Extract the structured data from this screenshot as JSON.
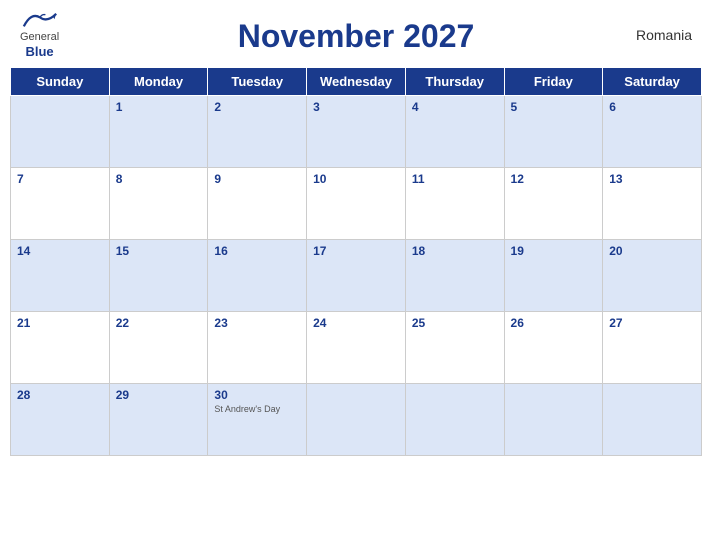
{
  "header": {
    "title": "November 2027",
    "country": "Romania",
    "logo": {
      "general": "General",
      "blue": "Blue"
    }
  },
  "weekdays": [
    "Sunday",
    "Monday",
    "Tuesday",
    "Wednesday",
    "Thursday",
    "Friday",
    "Saturday"
  ],
  "weeks": [
    [
      {
        "day": "",
        "holiday": ""
      },
      {
        "day": "1",
        "holiday": ""
      },
      {
        "day": "2",
        "holiday": ""
      },
      {
        "day": "3",
        "holiday": ""
      },
      {
        "day": "4",
        "holiday": ""
      },
      {
        "day": "5",
        "holiday": ""
      },
      {
        "day": "6",
        "holiday": ""
      }
    ],
    [
      {
        "day": "7",
        "holiday": ""
      },
      {
        "day": "8",
        "holiday": ""
      },
      {
        "day": "9",
        "holiday": ""
      },
      {
        "day": "10",
        "holiday": ""
      },
      {
        "day": "11",
        "holiday": ""
      },
      {
        "day": "12",
        "holiday": ""
      },
      {
        "day": "13",
        "holiday": ""
      }
    ],
    [
      {
        "day": "14",
        "holiday": ""
      },
      {
        "day": "15",
        "holiday": ""
      },
      {
        "day": "16",
        "holiday": ""
      },
      {
        "day": "17",
        "holiday": ""
      },
      {
        "day": "18",
        "holiday": ""
      },
      {
        "day": "19",
        "holiday": ""
      },
      {
        "day": "20",
        "holiday": ""
      }
    ],
    [
      {
        "day": "21",
        "holiday": ""
      },
      {
        "day": "22",
        "holiday": ""
      },
      {
        "day": "23",
        "holiday": ""
      },
      {
        "day": "24",
        "holiday": ""
      },
      {
        "day": "25",
        "holiday": ""
      },
      {
        "day": "26",
        "holiday": ""
      },
      {
        "day": "27",
        "holiday": ""
      }
    ],
    [
      {
        "day": "28",
        "holiday": ""
      },
      {
        "day": "29",
        "holiday": ""
      },
      {
        "day": "30",
        "holiday": "St Andrew's Day"
      },
      {
        "day": "",
        "holiday": ""
      },
      {
        "day": "",
        "holiday": ""
      },
      {
        "day": "",
        "holiday": ""
      },
      {
        "day": "",
        "holiday": ""
      }
    ]
  ],
  "colors": {
    "header_bg": "#1a3a8c",
    "header_text": "#ffffff",
    "row_odd": "#dce6f7",
    "row_even": "#ffffff",
    "day_number": "#1a3a8c",
    "border": "#cccccc"
  }
}
